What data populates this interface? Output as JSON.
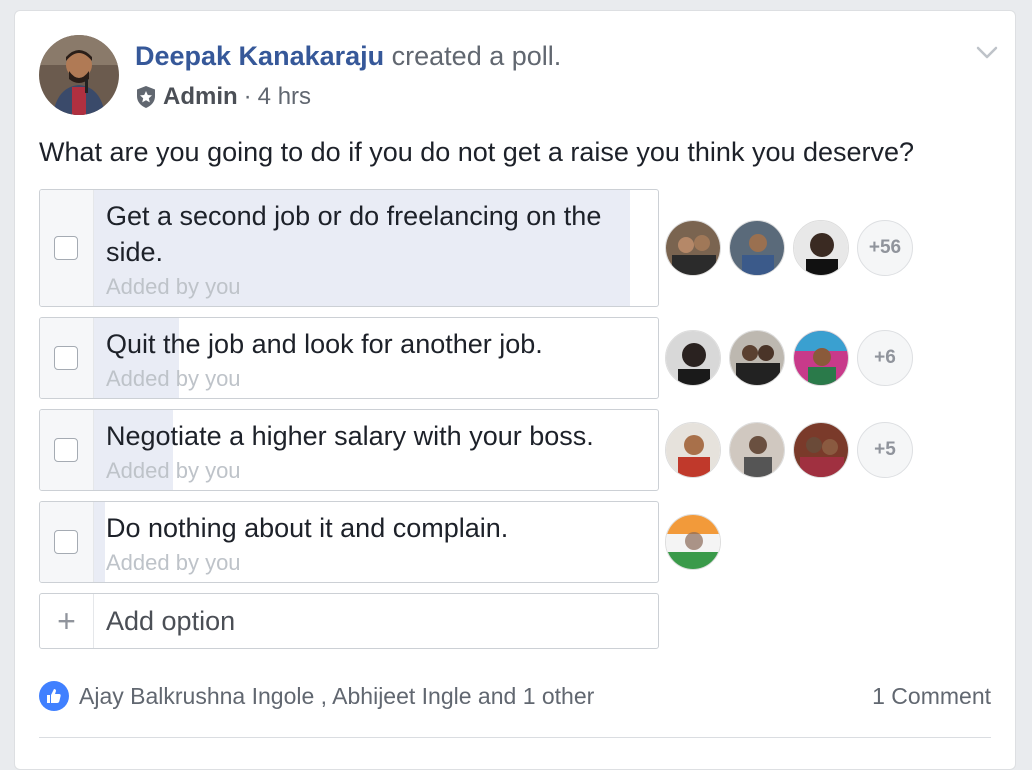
{
  "post": {
    "author": "Deepak Kanakaraju",
    "action": "created a poll.",
    "role": "Admin",
    "separator": "·",
    "time": "4 hrs",
    "question": "What are you going to do if you do not get a raise you think you deserve?"
  },
  "poll": {
    "options": [
      {
        "text": "Get a second job or do freelancing on the side.",
        "added_by": "Added by you",
        "votes_more": "+56",
        "vote_share": 0.95
      },
      {
        "text": "Quit the job and look for another job.",
        "added_by": "Added by you",
        "votes_more": "+6",
        "vote_share": 0.15
      },
      {
        "text": "Negotiate a higher salary with your boss.",
        "added_by": "Added by you",
        "votes_more": "+5",
        "vote_share": 0.14
      },
      {
        "text": "Do nothing about it and complain.",
        "added_by": "Added by you",
        "votes_more": "",
        "vote_share": 0.02
      }
    ],
    "add_option_placeholder": "Add option"
  },
  "footer": {
    "likers": "Ajay Balkrushna Ingole , Abhijeet Ingle and 1 other",
    "comments": "1 Comment"
  },
  "icons": {
    "menu": "chevron-down-icon",
    "admin": "admin-badge-icon",
    "like": "like-icon",
    "add": "plus-icon"
  },
  "colors": {
    "author_link": "#365899",
    "vote_fill": "#e9ecf5",
    "like_blue": "#4080ff",
    "muted_text": "#616770"
  }
}
